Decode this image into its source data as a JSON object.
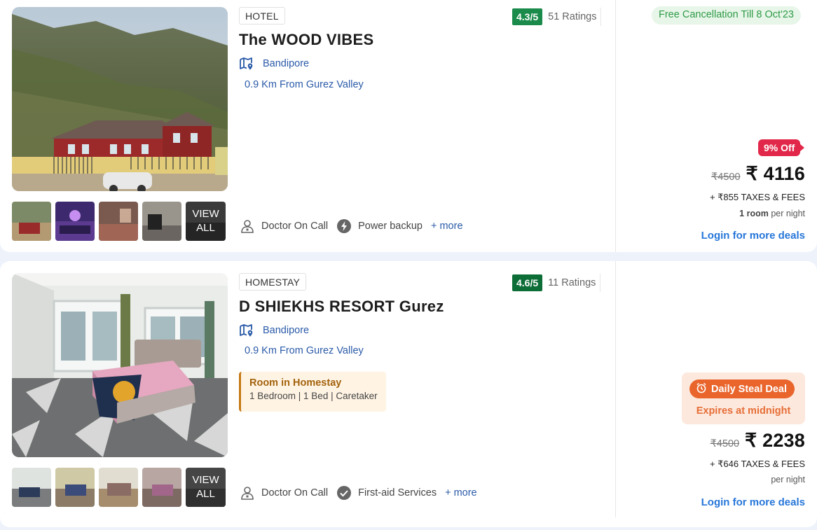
{
  "listings": [
    {
      "type": "HOTEL",
      "rating": "4.3/5",
      "ratings_count": "51 Ratings",
      "name": "The WOOD VIBES",
      "location": "Bandipore",
      "distance": "0.9 Km From Gurez Valley",
      "view_all": "VIEW ALL",
      "amenities": [
        "Doctor On Call",
        "Power backup"
      ],
      "more": "+ more",
      "free_cancellation": "Free Cancellation Till 8 Oct'23",
      "discount": "9% Off",
      "old_price": "₹4500",
      "price": "₹ 4116",
      "taxes": "+ ₹855 TAXES & FEES",
      "room_count": "1 room",
      "per_night": "per night",
      "login_deals": "Login for more deals"
    },
    {
      "type": "HOMESTAY",
      "rating": "4.6/5",
      "ratings_count": "11 Ratings",
      "name": "D SHIEKHS RESORT Gurez",
      "location": "Bandipore",
      "distance": "0.9 Km From Gurez Valley",
      "room_type": "Room in Homestay",
      "room_details": "1 Bedroom | 1 Bed | Caretaker",
      "view_all": "VIEW ALL",
      "amenities": [
        "Doctor On Call",
        "First-aid Services"
      ],
      "more": "+ more",
      "deal_label": "Daily Steal Deal",
      "deal_expiry": "Expires at midnight",
      "old_price": "₹4500",
      "price": "₹ 2238",
      "taxes": "+ ₹646 TAXES & FEES",
      "per_night": "per night",
      "login_deals": "Login for more deals"
    }
  ],
  "icons": {
    "location": "map-pin-icon",
    "doctor": "doctor-icon",
    "power": "lightning-icon",
    "first_aid": "check-circle-icon",
    "alarm": "alarm-clock-icon"
  },
  "colors": {
    "rating_green": "#1a8b4a",
    "link_blue": "#2676d9",
    "discount_red": "#e2284a",
    "deal_orange": "#e9652c",
    "cancel_green": "#2f9a47"
  }
}
